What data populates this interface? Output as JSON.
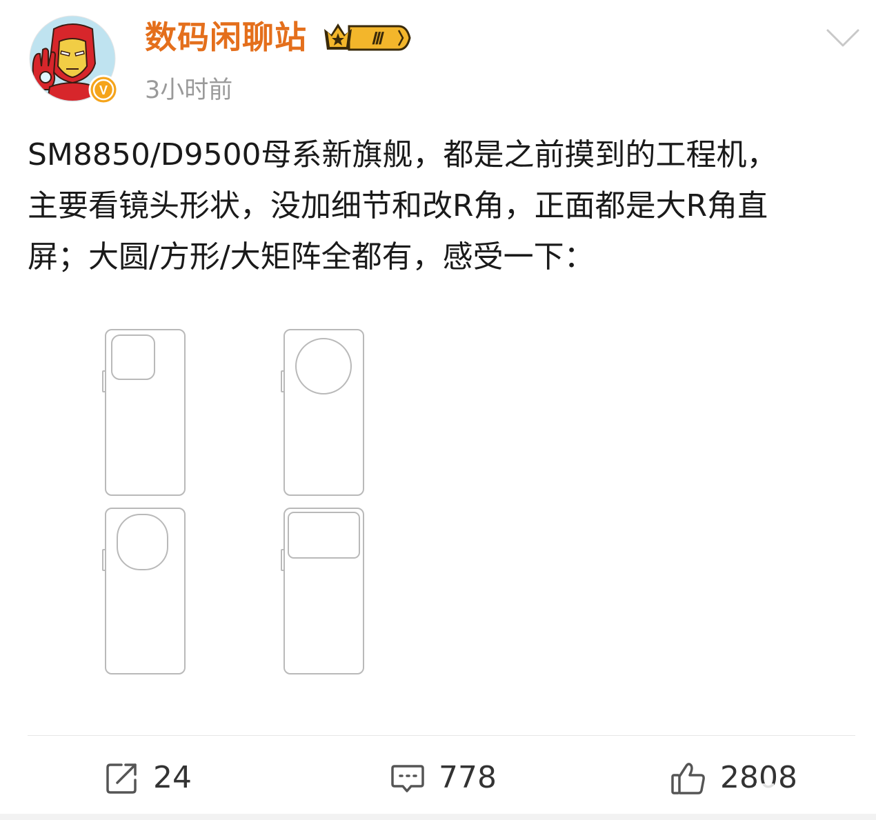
{
  "post": {
    "author": {
      "name": "数码闲聊站",
      "vip_level": "Ⅲ",
      "verified_badge": "V",
      "avatar_icon": "iron-man-avatar"
    },
    "timestamp": "3小时前",
    "text_lines": [
      "SM8850/D9500母系新旗舰，都是之前摸到的工程机，",
      "主要看镜头形状，没加细节和改R角，正面都是大R角直",
      "屏；大圆/方形/大矩阵全都有，感受一下："
    ]
  },
  "actions": {
    "repost_count": "24",
    "comment_count": "778",
    "like_count": "2808"
  },
  "colors": {
    "username": "#e46f1c",
    "timestamp": "#9a9a9a",
    "text": "#1a1a1a",
    "icon": "#555555"
  },
  "icons": {
    "more": "chevron-down-icon",
    "repost": "repost-icon",
    "comment": "comment-icon",
    "like": "thumb-up-icon"
  }
}
